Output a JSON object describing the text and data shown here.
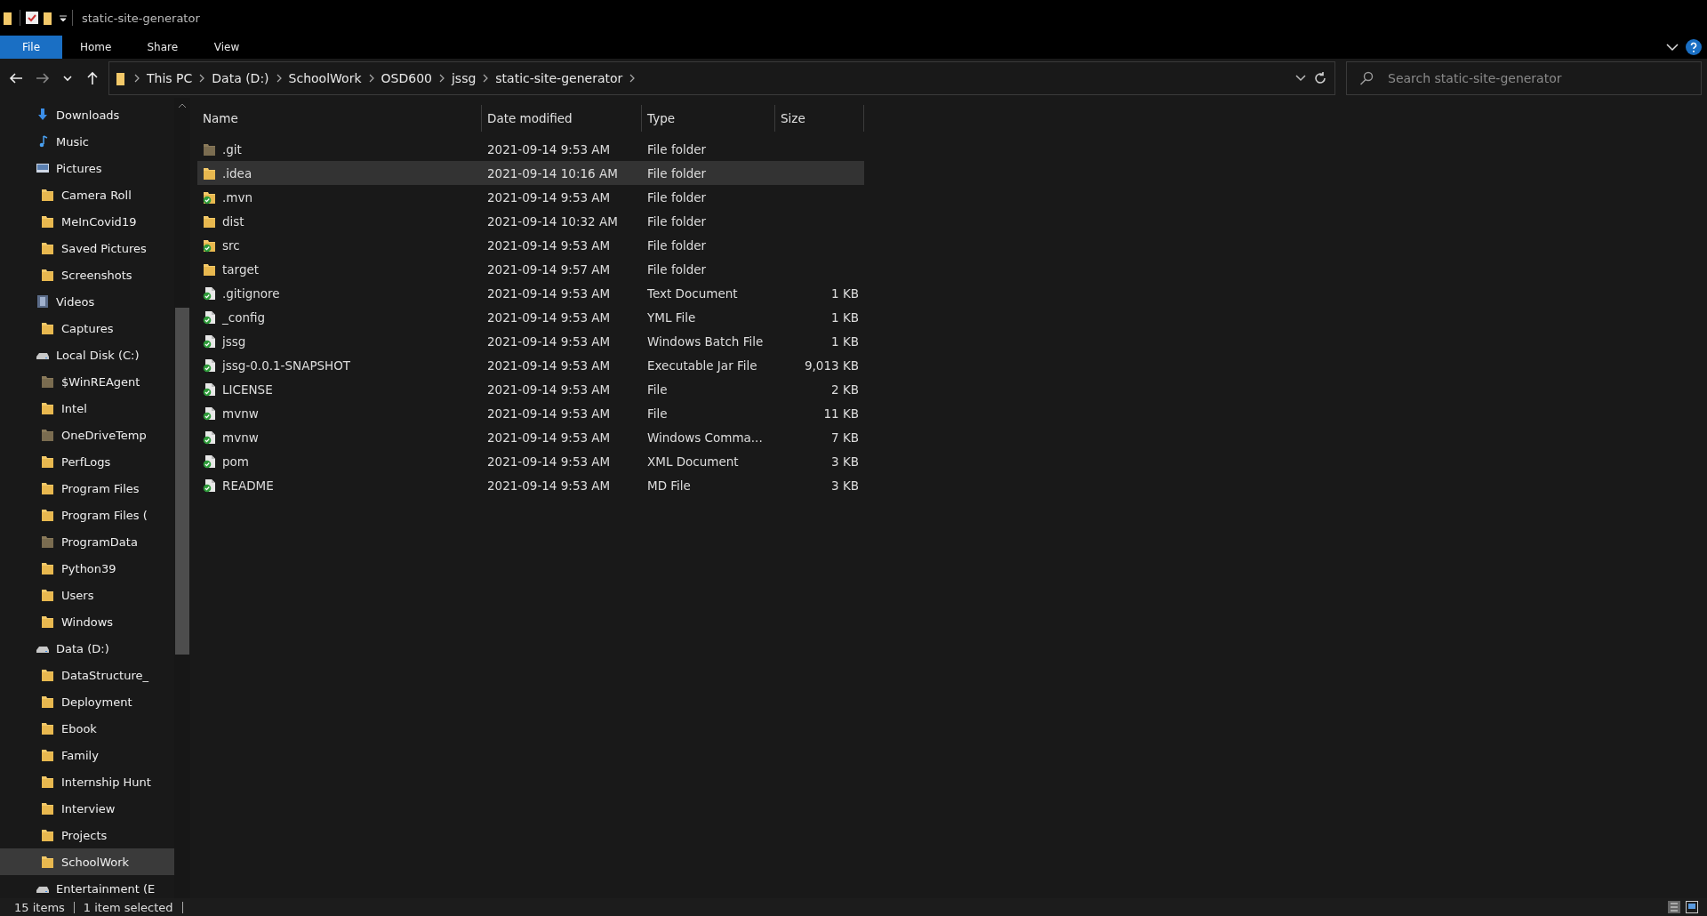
{
  "window": {
    "title": "static-site-generator"
  },
  "ribbon_tabs": [
    {
      "label": "File",
      "selected": true
    },
    {
      "label": "Home",
      "selected": false
    },
    {
      "label": "Share",
      "selected": false
    },
    {
      "label": "View",
      "selected": false
    }
  ],
  "breadcrumb": [
    "This PC",
    "Data (D:)",
    "SchoolWork",
    "OSD600",
    "jssg",
    "static-site-generator"
  ],
  "search": {
    "placeholder": "Search static-site-generator"
  },
  "sidebar": {
    "items": [
      {
        "label": "Downloads",
        "kind": "download",
        "selected": false
      },
      {
        "label": "Music",
        "kind": "music",
        "selected": false
      },
      {
        "label": "Pictures",
        "kind": "pictures",
        "selected": false,
        "children": [
          {
            "label": "Camera Roll",
            "kind": "folder",
            "selected": false
          },
          {
            "label": "MeInCovid19",
            "kind": "folder",
            "selected": false
          },
          {
            "label": "Saved Pictures",
            "kind": "folder",
            "selected": false
          },
          {
            "label": "Screenshots",
            "kind": "folder",
            "selected": false
          }
        ]
      },
      {
        "label": "Videos",
        "kind": "video",
        "selected": false,
        "children": [
          {
            "label": "Captures",
            "kind": "folder",
            "selected": false
          }
        ]
      },
      {
        "label": "Local Disk (C:)",
        "kind": "drive",
        "selected": false,
        "children": [
          {
            "label": "$WinREAgent",
            "kind": "hidden",
            "selected": false
          },
          {
            "label": "Intel",
            "kind": "folder",
            "selected": false
          },
          {
            "label": "OneDriveTemp",
            "kind": "hidden",
            "selected": false
          },
          {
            "label": "PerfLogs",
            "kind": "folder",
            "selected": false
          },
          {
            "label": "Program Files",
            "kind": "folder",
            "selected": false
          },
          {
            "label": "Program Files (",
            "kind": "folder",
            "selected": false
          },
          {
            "label": "ProgramData",
            "kind": "hidden",
            "selected": false
          },
          {
            "label": "Python39",
            "kind": "folder",
            "selected": false
          },
          {
            "label": "Users",
            "kind": "folder",
            "selected": false
          },
          {
            "label": "Windows",
            "kind": "folder",
            "selected": false
          }
        ]
      },
      {
        "label": "Data (D:)",
        "kind": "drive",
        "selected": false,
        "children": [
          {
            "label": "DataStructure_",
            "kind": "folder",
            "selected": false
          },
          {
            "label": "Deployment",
            "kind": "folder",
            "selected": false
          },
          {
            "label": "Ebook",
            "kind": "folder",
            "selected": false
          },
          {
            "label": "Family",
            "kind": "folder",
            "selected": false
          },
          {
            "label": "Internship Hunt",
            "kind": "folder",
            "selected": false
          },
          {
            "label": "Interview",
            "kind": "folder",
            "selected": false
          },
          {
            "label": "Projects",
            "kind": "folder",
            "selected": false
          },
          {
            "label": "SchoolWork",
            "kind": "folder",
            "selected": true
          }
        ]
      },
      {
        "label": "Entertainment (E",
        "kind": "drive",
        "selected": false
      }
    ]
  },
  "table": {
    "columns": [
      "Name",
      "Date modified",
      "Type",
      "Size"
    ],
    "rows": [
      {
        "name": ".git",
        "date": "2021-09-14 9:53 AM",
        "type": "File folder",
        "kind": "hidden",
        "synced": false,
        "selected": false
      },
      {
        "name": ".idea",
        "date": "2021-09-14 10:16 AM",
        "type": "File folder",
        "kind": "folder",
        "synced": false,
        "selected": true
      },
      {
        "name": ".mvn",
        "date": "2021-09-14 9:53 AM",
        "type": "File folder",
        "kind": "folder",
        "synced": true,
        "selected": false
      },
      {
        "name": "dist",
        "date": "2021-09-14 10:32 AM",
        "type": "File folder",
        "kind": "folder",
        "synced": false,
        "selected": false
      },
      {
        "name": "src",
        "date": "2021-09-14 9:53 AM",
        "type": "File folder",
        "kind": "folder",
        "synced": true,
        "selected": false
      },
      {
        "name": "target",
        "date": "2021-09-14 9:57 AM",
        "type": "File folder",
        "kind": "folder",
        "synced": false,
        "selected": false
      },
      {
        "name": ".gitignore",
        "date": "2021-09-14 9:53 AM",
        "type": "Text Document",
        "size": "1 KB",
        "kind": "file",
        "synced": true,
        "selected": false
      },
      {
        "name": "_config",
        "date": "2021-09-14 9:53 AM",
        "type": "YML File",
        "size": "1 KB",
        "kind": "file",
        "synced": true,
        "selected": false
      },
      {
        "name": "jssg",
        "date": "2021-09-14 9:53 AM",
        "type": "Windows Batch File",
        "size": "1 KB",
        "kind": "file",
        "synced": true,
        "selected": false
      },
      {
        "name": "jssg-0.0.1-SNAPSHOT",
        "date": "2021-09-14 9:53 AM",
        "type": "Executable Jar File",
        "size": "9,013 KB",
        "kind": "file",
        "synced": true,
        "selected": false
      },
      {
        "name": "LICENSE",
        "date": "2021-09-14 9:53 AM",
        "type": "File",
        "size": "2 KB",
        "kind": "file",
        "synced": true,
        "selected": false
      },
      {
        "name": "mvnw",
        "date": "2021-09-14 9:53 AM",
        "type": "File",
        "size": "11 KB",
        "kind": "file",
        "synced": true,
        "selected": false
      },
      {
        "name": "mvnw",
        "date": "2021-09-14 9:53 AM",
        "type": "Windows Comma...",
        "size": "7 KB",
        "kind": "file",
        "synced": true,
        "selected": false
      },
      {
        "name": "pom",
        "date": "2021-09-14 9:53 AM",
        "type": "XML Document",
        "size": "3 KB",
        "kind": "file",
        "synced": true,
        "selected": false
      },
      {
        "name": "README",
        "date": "2021-09-14 9:53 AM",
        "type": "MD File",
        "size": "3 KB",
        "kind": "file",
        "synced": true,
        "selected": false
      }
    ]
  },
  "status_bar": [
    "15 items",
    "1 item selected"
  ]
}
